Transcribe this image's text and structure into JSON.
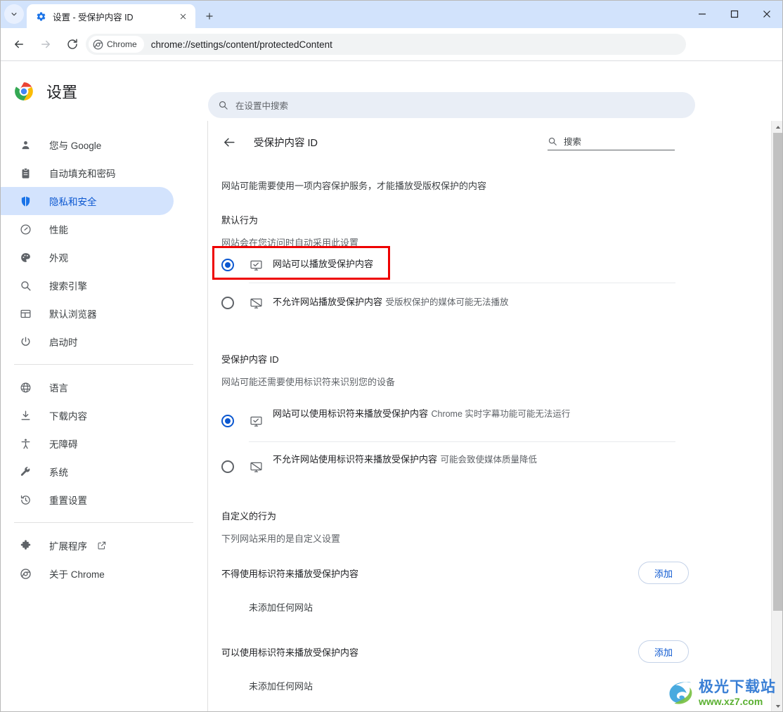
{
  "window": {
    "tab_title": "设置 - 受保护内容 ID",
    "favicon": "gear-icon",
    "new_tab_label": "+",
    "minimize_label": "—",
    "maximize_label": "□",
    "close_label": "✕",
    "accent_color": "#0b57d0",
    "tabstrip_color": "#d2e3fc"
  },
  "toolbar": {
    "back_label": "←",
    "forward_label": "→",
    "reload_label": "⟳",
    "chrome_chip_label": "Chrome",
    "url": "chrome://settings/content/protectedContent",
    "star_label": "☆",
    "menu_label": "⋮"
  },
  "settings_header": {
    "title": "设置",
    "search_placeholder": "在设置中搜索"
  },
  "sidebar": {
    "groups": [
      {
        "items": [
          {
            "label": "您与 Google",
            "icon": "person-icon",
            "active": false
          },
          {
            "label": "自动填充和密码",
            "icon": "clipboard-icon",
            "active": false
          },
          {
            "label": "隐私和安全",
            "icon": "shield-icon",
            "active": true
          },
          {
            "label": "性能",
            "icon": "speedometer-icon",
            "active": false
          },
          {
            "label": "外观",
            "icon": "palette-icon",
            "active": false
          },
          {
            "label": "搜索引擎",
            "icon": "search-icon",
            "active": false
          },
          {
            "label": "默认浏览器",
            "icon": "browser-window-icon",
            "active": false
          },
          {
            "label": "启动时",
            "icon": "power-icon",
            "active": false
          }
        ]
      },
      {
        "items": [
          {
            "label": "语言",
            "icon": "globe-icon",
            "active": false
          },
          {
            "label": "下载内容",
            "icon": "download-icon",
            "active": false
          },
          {
            "label": "无障碍",
            "icon": "accessibility-icon",
            "active": false
          },
          {
            "label": "系统",
            "icon": "wrench-icon",
            "active": false
          },
          {
            "label": "重置设置",
            "icon": "history-restore-icon",
            "active": false
          }
        ]
      },
      {
        "items": [
          {
            "label": "扩展程序",
            "icon": "puzzle-icon",
            "active": false,
            "external": true
          },
          {
            "label": "关于 Chrome",
            "icon": "chrome-logo-icon",
            "active": false
          }
        ]
      }
    ]
  },
  "content": {
    "back_label": "←",
    "title": "受保护内容 ID",
    "search_placeholder": "搜索",
    "intro": "网站可能需要使用一项内容保护服务，才能播放受版权保护的内容",
    "default_behavior": {
      "heading": "默认行为",
      "description": "网站会在您访问时自动采用此设置",
      "options": [
        {
          "label": "网站可以播放受保护内容",
          "sub": "",
          "icon": "monitor-check-icon",
          "selected": true,
          "highlighted": true
        },
        {
          "label": "不允许网站播放受保护内容",
          "sub": "受版权保护的媒体可能无法播放",
          "icon": "monitor-blocked-icon",
          "selected": false,
          "highlighted": false
        }
      ]
    },
    "protected_content_id": {
      "heading": "受保护内容 ID",
      "description": "网站可能还需要使用标识符来识别您的设备",
      "options": [
        {
          "label": "网站可以使用标识符来播放受保护内容",
          "sub": "Chrome 实时字幕功能可能无法运行",
          "icon": "monitor-check-icon",
          "selected": true,
          "highlighted": false
        },
        {
          "label": "不允许网站使用标识符来播放受保护内容",
          "sub": "可能会致使媒体质量降低",
          "icon": "monitor-blocked-icon",
          "selected": false,
          "highlighted": false
        }
      ]
    },
    "custom_behavior": {
      "heading": "自定义的行为",
      "description": "下列网站采用的是自定义设置",
      "groups": [
        {
          "label": "不得使用标识符来播放受保护内容",
          "button_label": "添加",
          "empty_note": "未添加任何网站"
        },
        {
          "label": "可以使用标识符来播放受保护内容",
          "button_label": "添加",
          "empty_note": "未添加任何网站"
        }
      ]
    }
  },
  "watermark": {
    "main": "极光下载站",
    "sub": "www.xz7.com"
  }
}
